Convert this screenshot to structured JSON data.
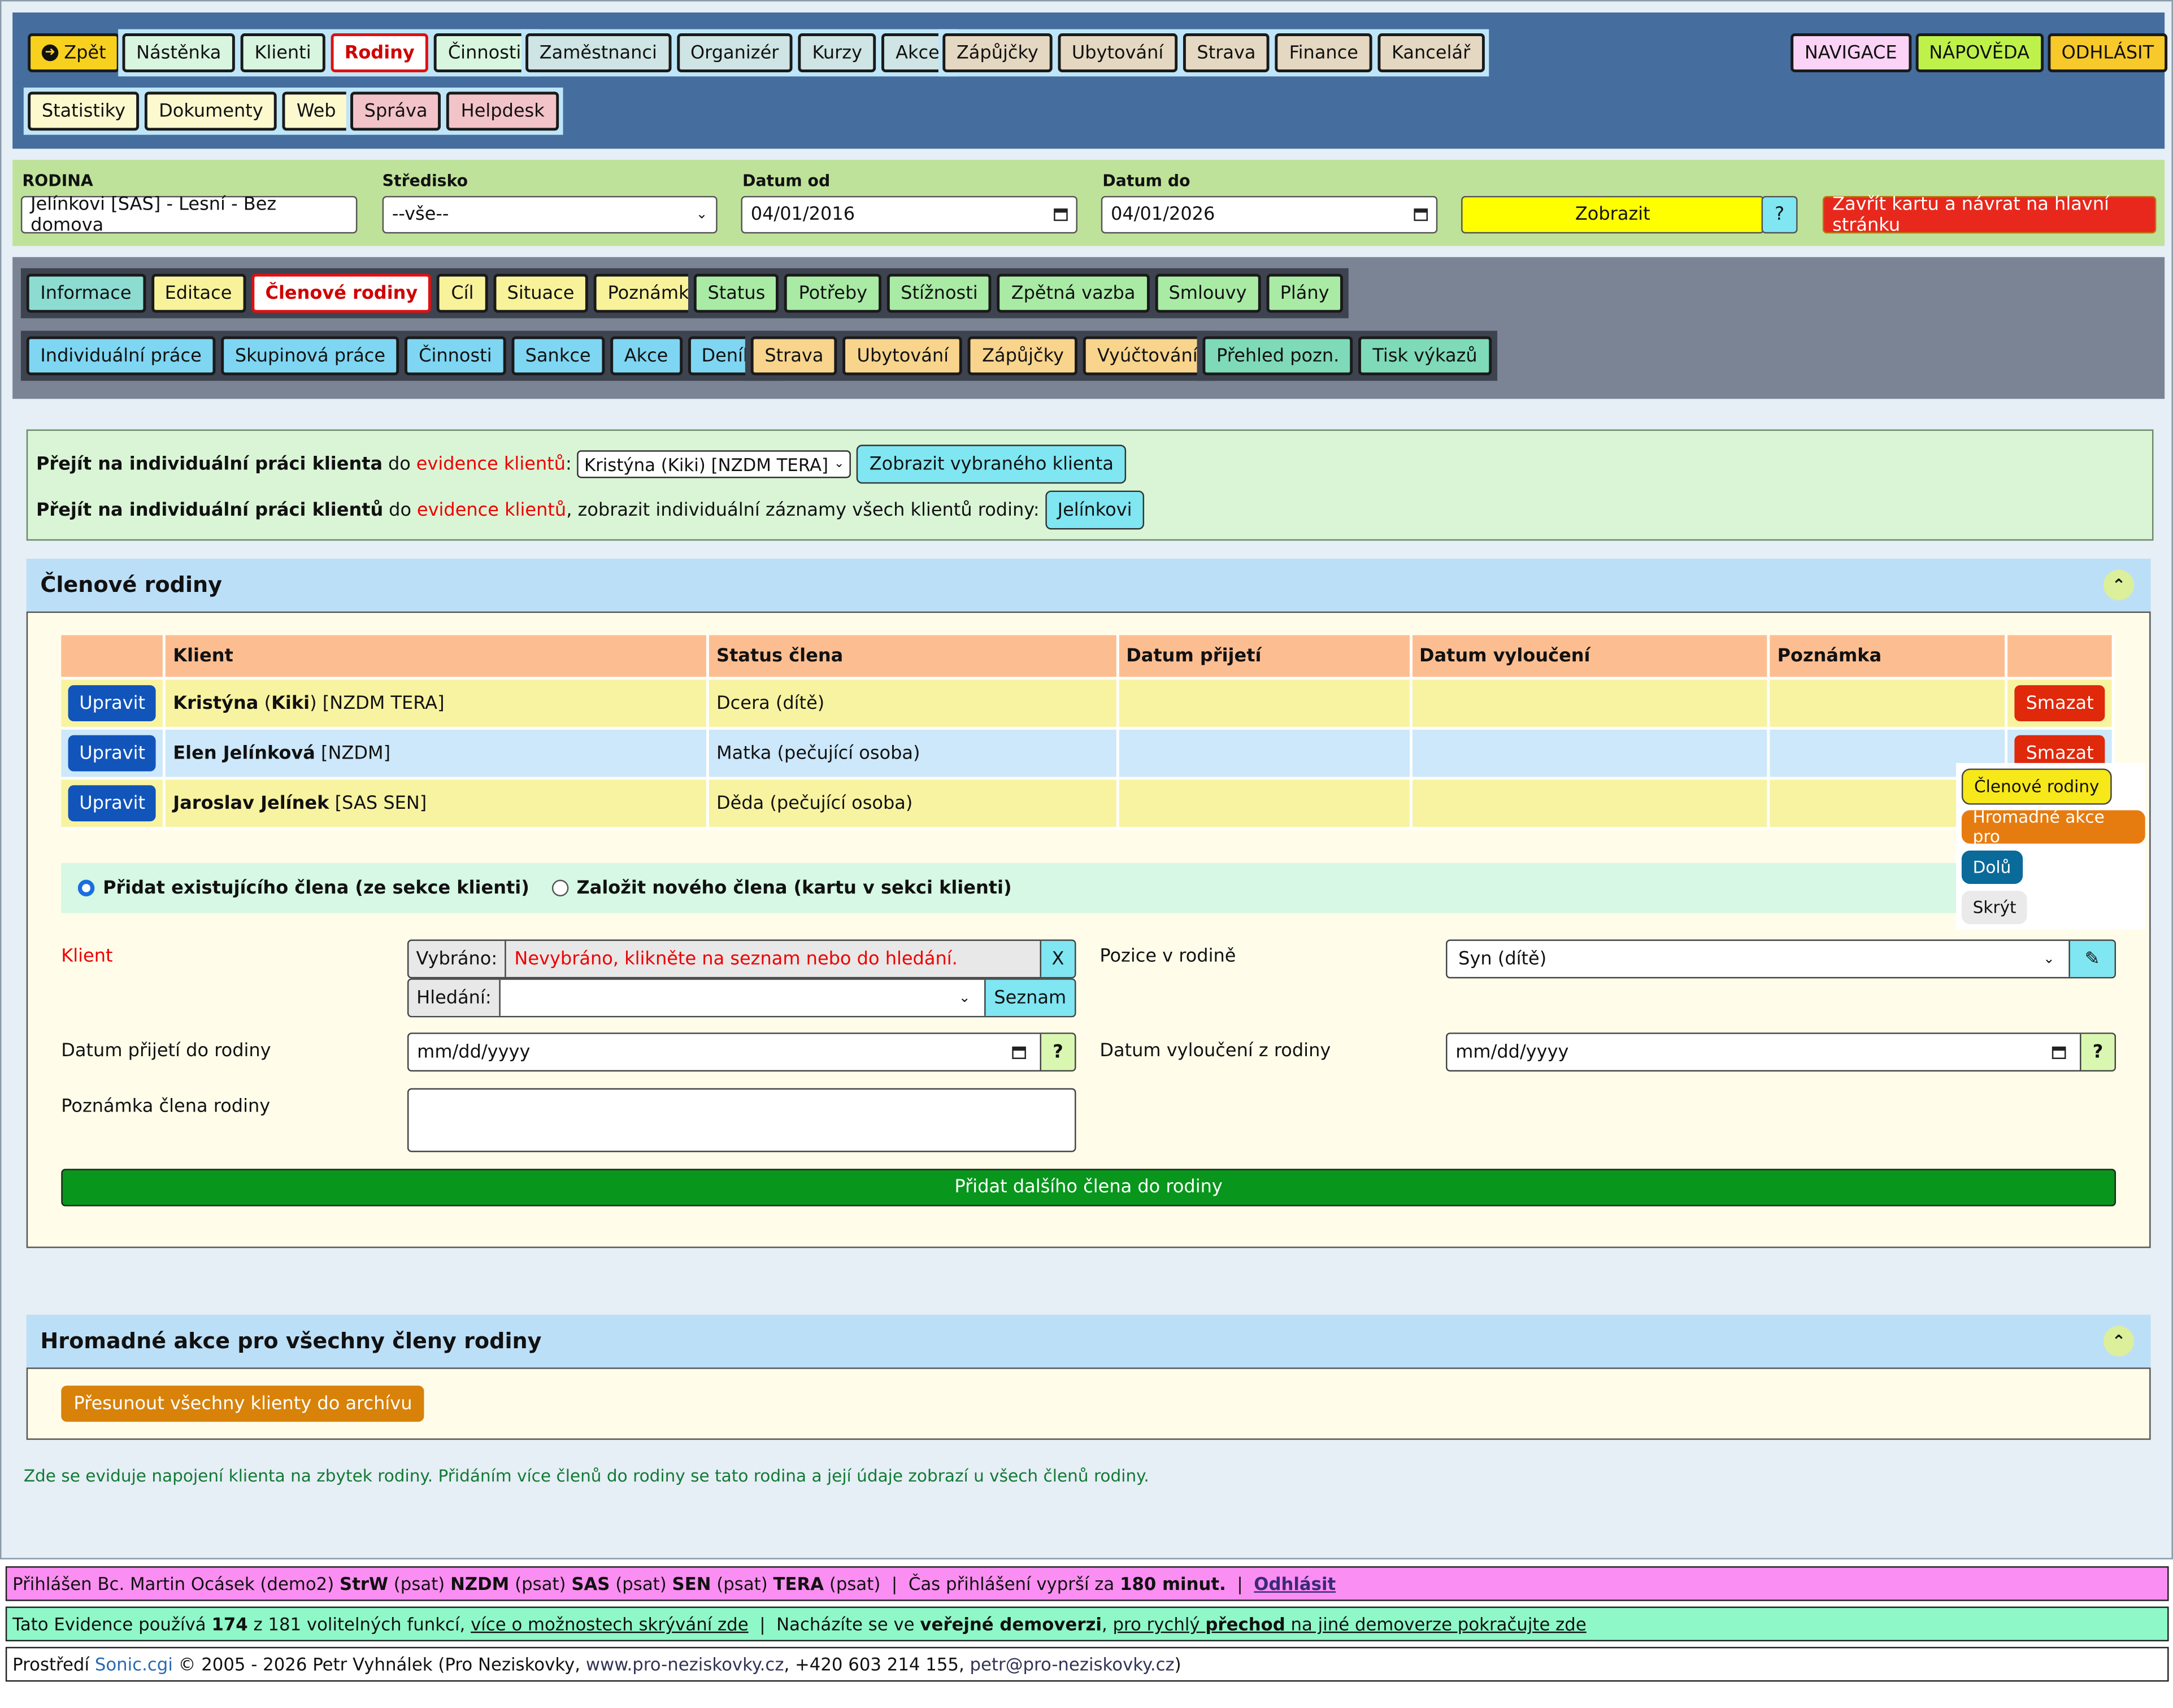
{
  "nav": {
    "back": "Zpět",
    "items1": [
      "Nástěnka",
      "Klienti",
      "Rodiny",
      "Činnosti"
    ],
    "items2": [
      "Zaměstnanci",
      "Organizér",
      "Kurzy",
      "Akce"
    ],
    "items3": [
      "Zápůjčky",
      "Ubytování",
      "Strava",
      "Finance",
      "Kancelář"
    ],
    "items4": [
      "Statistiky",
      "Dokumenty",
      "Web"
    ],
    "items5": [
      "Správa",
      "Helpdesk"
    ],
    "right": [
      "NAVIGACE",
      "NÁPOVĚDA",
      "ODHLÁSIT"
    ]
  },
  "filter": {
    "family_label": "RODINA",
    "family_value": "Jelínkovi [SAS] - Lesní - Bez domova",
    "center_label": "Středisko",
    "center_value": "--vše--",
    "from_label": "Datum od",
    "from_value": "04/01/2016",
    "to_label": "Datum do",
    "to_value": "04/01/2026",
    "show_btn": "Zobrazit",
    "help_btn": "?",
    "close_btn": "Zavřít kartu a návrat na hlavní stránku"
  },
  "tabs": {
    "row1a": [
      "Informace",
      "Editace",
      "Členové rodiny",
      "Cíl",
      "Situace",
      "Poznámky"
    ],
    "row1b": [
      "Status",
      "Potřeby",
      "Stížnosti",
      "Zpětná vazba",
      "Smlouvy",
      "Plány"
    ],
    "row2a": [
      "Individuální práce",
      "Skupinová práce",
      "Činnosti",
      "Sankce",
      "Akce",
      "Deníky"
    ],
    "row2b": [
      "Strava",
      "Ubytování",
      "Zápůjčky",
      "Vyúčtování"
    ],
    "row2c": [
      "Přehled pozn.",
      "Tisk výkazů"
    ]
  },
  "goto": {
    "l1_bold": "Přejít na individuální práci klienta",
    "l1_mid": "do",
    "l1_link": "evidence klientů",
    "l1_colon": ":",
    "l1_select": "Kristýna (Kiki) [NZDM TERA]",
    "l1_btn": "Zobrazit vybraného klienta",
    "l2_bold": "Přejít na individuální práci klientů",
    "l2_mid": "do",
    "l2_link": "evidence klientů",
    "l2_rest": ", zobrazit individuální záznamy všech klientů rodiny:",
    "l2_btn": "Jelínkovi"
  },
  "members": {
    "title": "Členové rodiny",
    "headers": [
      "Klient",
      "Status člena",
      "Datum přijetí",
      "Datum vyloučení",
      "Poznámka"
    ],
    "edit": "Upravit",
    "delete": "Smazat",
    "rows": [
      {
        "n1": "Kristýna",
        "p1": " (",
        "n2": "Kiki",
        "p2": ") ",
        "tag": "[NZDM TERA]",
        "status": "Dcera (dítě)"
      },
      {
        "n1": "Elen Jelínková",
        "p1": " ",
        "n2": "",
        "p2": "",
        "tag": "[NZDM]",
        "status": "Matka (pečující osoba)"
      },
      {
        "n1": "Jaroslav Jelínek",
        "p1": " ",
        "n2": "",
        "p2": "",
        "tag": "[SAS SEN]",
        "status": "Děda (pečující osoba)"
      }
    ],
    "radio1": "Přidat existujícího člena (ze sekce klienti)",
    "radio2": "Založit nového člena (kartu v sekci klienti)",
    "client_label": "Klient",
    "selected_label": "Vybráno:",
    "selected_value": "Nevybráno, klikněte na seznam nebo do hledání.",
    "clear": "X",
    "search_label": "Hledání:",
    "list_btn": "Seznam",
    "position_label": "Pozice v rodině",
    "position_value": "Syn (dítě)",
    "join_label": "Datum přijetí do rodiny",
    "date_placeholder": "mm/dd/yyyy",
    "exclude_label": "Datum vyloučení z rodiny",
    "note_label": "Poznámka člena rodiny",
    "q": "?",
    "add_btn": "Přidat dalšího člena do rodiny"
  },
  "popup": [
    "Členové rodiny",
    "Hromadné akce pro",
    "Dolů",
    "Skrýt"
  ],
  "bulk": {
    "title": "Hromadné akce pro všechny členy rodiny",
    "archive_btn": "Přesunout všechny klienty do archívu"
  },
  "info_text": "Zde se eviduje napojení klienta na zbytek rodiny. Přidáním více členů do rodiny se tato rodina a její údaje zobrazí u všech členů rodiny.",
  "footer": {
    "login_prefix": "Přihlášen Bc. Martin Ocásek (demo2)",
    "roles": [
      {
        "name": "StrW",
        "suffix": "(psat)"
      },
      {
        "name": "NZDM",
        "suffix": "(psat)"
      },
      {
        "name": "SAS",
        "suffix": "(psat)"
      },
      {
        "name": "SEN",
        "suffix": "(psat)"
      },
      {
        "name": "TERA",
        "suffix": "(psat)"
      }
    ],
    "sep": "|",
    "expire_text": "Čas přihlášení vyprší za",
    "expire_value": "180 minut.",
    "logout": "Odhlásit",
    "f2_a": "Tato Evidence používá",
    "f2_count": "174",
    "f2_b": "z 181 volitelných funkcí,",
    "f2_link1": "více o možnostech skrývání zde",
    "f2_c": "Nacházíte se ve",
    "f2_bold": "veřejné demoverzi",
    "f2_link2a": "pro rychlý",
    "f2_link2b": "přechod",
    "f2_link2c": "na jiné demoverze pokračujte zde",
    "f3_a": "Prostředí",
    "f3_sonic": "Sonic.cgi",
    "f3_b": "© 2005 - 2026 Petr Vyhnálek (Pro Neziskovky,",
    "f3_web": "www.pro-neziskovky.cz",
    "f3_c": ", +420 603 214 155,",
    "f3_mail": "petr@pro-neziskovky.cz",
    "f3_d": ")"
  }
}
